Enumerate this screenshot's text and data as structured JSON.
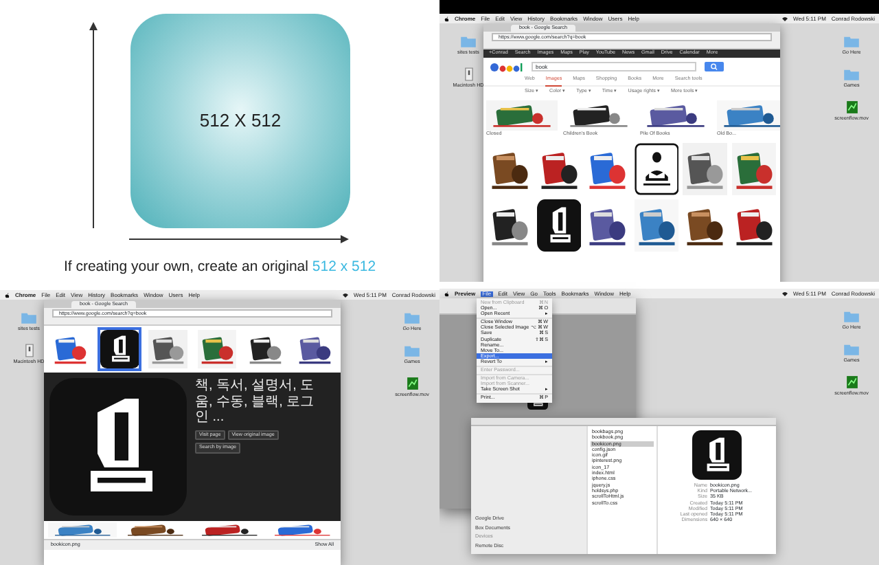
{
  "slide": {
    "size_label": "512 X 512",
    "caption": "If creating your own, create an original",
    "caption_highlight": "512 x 512"
  },
  "browser_screen": {
    "menubar": {
      "app": "Chrome",
      "items": [
        "File",
        "Edit",
        "View",
        "History",
        "Bookmarks",
        "Window",
        "Users",
        "Help"
      ],
      "clock": "Wed 5:11 PM",
      "user": "Conrad Rodowski"
    },
    "desktop_left": [
      {
        "kind": "folder",
        "label": "sites tests"
      },
      {
        "kind": "drive",
        "label": "Macintosh HD"
      }
    ],
    "desktop_right": [
      {
        "kind": "folder",
        "label": "Go Here"
      },
      {
        "kind": "folder",
        "label": "Games"
      },
      {
        "kind": "movie",
        "label": "screenflow.mov"
      }
    ],
    "tab": "book - Google Search",
    "address": "https://www.google.com/search?q=book",
    "google_bar": [
      "+Conrad",
      "Search",
      "Images",
      "Maps",
      "Play",
      "YouTube",
      "News",
      "Gmail",
      "Drive",
      "Calendar",
      "More"
    ],
    "query": "book",
    "search_tabs": [
      {
        "label": "Web",
        "selected": false
      },
      {
        "label": "Images",
        "selected": true
      },
      {
        "label": "Maps",
        "selected": false
      },
      {
        "label": "Shopping",
        "selected": false
      },
      {
        "label": "Books",
        "selected": false
      },
      {
        "label": "More",
        "selected": false
      },
      {
        "label": "Search tools",
        "selected": false
      }
    ],
    "filters": [
      "Size ▾",
      "Color ▾",
      "Type ▾",
      "Time ▾",
      "Usage rights ▾",
      "More tools ▾"
    ],
    "related": [
      "Closed",
      "Children's Book",
      "Pile Of Books",
      "Old Bo..."
    ],
    "results": [
      {
        "kind": "picture"
      },
      {
        "kind": "picture"
      },
      {
        "kind": "picture"
      },
      {
        "kind": "reader-icon"
      },
      {
        "kind": "picture"
      },
      {
        "kind": "picture"
      },
      {
        "kind": "picture"
      },
      {
        "kind": "book-icon"
      },
      {
        "kind": "picture"
      },
      {
        "kind": "picture"
      },
      {
        "kind": "picture"
      },
      {
        "kind": "picture"
      }
    ]
  },
  "preview_screen": {
    "menubar": {
      "app": "Chrome",
      "items": [
        "File",
        "Edit",
        "View",
        "History",
        "Bookmarks",
        "Window",
        "Users",
        "Help"
      ],
      "clock": "Wed 5:11 PM",
      "user": "Conrad Rodowski"
    },
    "desktop_left": [
      {
        "kind": "folder",
        "label": "sites tests"
      },
      {
        "kind": "drive",
        "label": "Macintosh HD"
      }
    ],
    "desktop_right": [
      {
        "kind": "folder",
        "label": "Go Here"
      },
      {
        "kind": "folder",
        "label": "Games"
      },
      {
        "kind": "movie",
        "label": "screenflow.mov"
      }
    ],
    "tab": "book - Google Search",
    "address": "https://www.google.com/search?q=book",
    "results": [
      {
        "kind": "picture",
        "selected": false
      },
      {
        "kind": "book-icon",
        "selected": true
      },
      {
        "kind": "picture",
        "selected": false
      },
      {
        "kind": "picture",
        "selected": false
      },
      {
        "kind": "picture",
        "selected": false
      },
      {
        "kind": "picture",
        "selected": false
      }
    ],
    "panel": {
      "title": "책, 독서, 설명서, 도움, 수동, 블랙, 로그인 ...",
      "buttons": [
        "Visit page",
        "View original image",
        "Search by image"
      ]
    },
    "download": {
      "file": "bookicon.png",
      "show_all": "Show All"
    }
  },
  "preview_app": {
    "menubar": {
      "app": "Preview",
      "items": [
        {
          "label": "File",
          "selected": true
        },
        {
          "label": "Edit",
          "selected": false
        },
        {
          "label": "View",
          "selected": false
        },
        {
          "label": "Go",
          "selected": false
        },
        {
          "label": "Tools",
          "selected": false
        },
        {
          "label": "Bookmarks",
          "selected": false
        },
        {
          "label": "Window",
          "selected": false
        },
        {
          "label": "Help",
          "selected": false
        }
      ],
      "clock": "Wed 5:11 PM",
      "user": "Conrad Rodowski"
    },
    "desktop_right": [
      {
        "kind": "folder",
        "label": "Go Here"
      },
      {
        "kind": "folder",
        "label": "Games"
      },
      {
        "kind": "movie",
        "label": "screenflow.mov"
      }
    ],
    "file_menu": [
      {
        "label": "New from Clipboard",
        "shortcut": "⌘N",
        "disabled": true,
        "selected": false
      },
      {
        "label": "Open...",
        "shortcut": "⌘O",
        "disabled": false,
        "selected": false
      },
      {
        "label": "Open Recent",
        "shortcut": "▸",
        "disabled": false,
        "selected": false
      },
      {
        "kind": "separator"
      },
      {
        "label": "Close Window",
        "shortcut": "⌘W",
        "disabled": false,
        "selected": false
      },
      {
        "label": "Close Selected Image",
        "shortcut": "⌥⌘W",
        "disabled": false,
        "selected": false
      },
      {
        "label": "Save",
        "shortcut": "⌘S",
        "disabled": false,
        "selected": false
      },
      {
        "label": "Duplicate",
        "shortcut": "⇧⌘S",
        "disabled": false,
        "selected": false
      },
      {
        "label": "Rename...",
        "disabled": false,
        "selected": false
      },
      {
        "label": "Move To...",
        "disabled": false,
        "selected": false
      },
      {
        "label": "Export...",
        "disabled": false,
        "selected": true
      },
      {
        "label": "Revert To",
        "shortcut": "▸",
        "disabled": false,
        "selected": false
      },
      {
        "kind": "separator"
      },
      {
        "label": "Enter Password...",
        "disabled": true,
        "selected": false
      },
      {
        "kind": "separator"
      },
      {
        "label": "Import from Camera...",
        "disabled": true,
        "selected": false
      },
      {
        "label": "Import from Scanner...",
        "disabled": true,
        "selected": false
      },
      {
        "label": "Take Screen Shot",
        "shortcut": "▸",
        "disabled": false,
        "selected": false
      },
      {
        "kind": "separator"
      },
      {
        "label": "Print...",
        "shortcut": "⌘P",
        "disabled": false,
        "selected": false
      }
    ],
    "sidebar": [
      "Google Drive",
      "Box Documents"
    ],
    "sidebar_heading": "Devices",
    "device": "Remote Disc",
    "files": [
      {
        "name": "bookbags.png",
        "selected": false
      },
      {
        "name": "bookbook.png",
        "selected": false
      },
      {
        "name": "bookicon.png",
        "selected": true
      },
      {
        "name": "config.json",
        "selected": false
      },
      {
        "name": "icon.gif",
        "selected": false
      },
      {
        "name": "ipinterest.png",
        "selected": false
      },
      {
        "name": "icon_17",
        "selected": false
      },
      {
        "name": "index.html",
        "selected": false
      },
      {
        "name": "iphone.css",
        "selected": false
      },
      {
        "name": "jquery.js",
        "selected": false
      },
      {
        "name": "holdsys.php",
        "selected": false
      },
      {
        "name": "scrollToHtml.js",
        "selected": false
      },
      {
        "name": "scrollTo.css",
        "selected": false
      }
    ],
    "info": [
      {
        "label": "Name",
        "value": "bookicon.png"
      },
      {
        "label": "Kind",
        "value": "Portable Network..."
      },
      {
        "label": "Size",
        "value": "35 KB"
      },
      {
        "label": "Created",
        "value": "Today 5:11 PM"
      },
      {
        "label": "Modified",
        "value": "Today 5:11 PM"
      },
      {
        "label": "Last opened",
        "value": "Today 5:11 PM"
      },
      {
        "label": "Dimensions",
        "value": "640 × 640"
      }
    ]
  }
}
